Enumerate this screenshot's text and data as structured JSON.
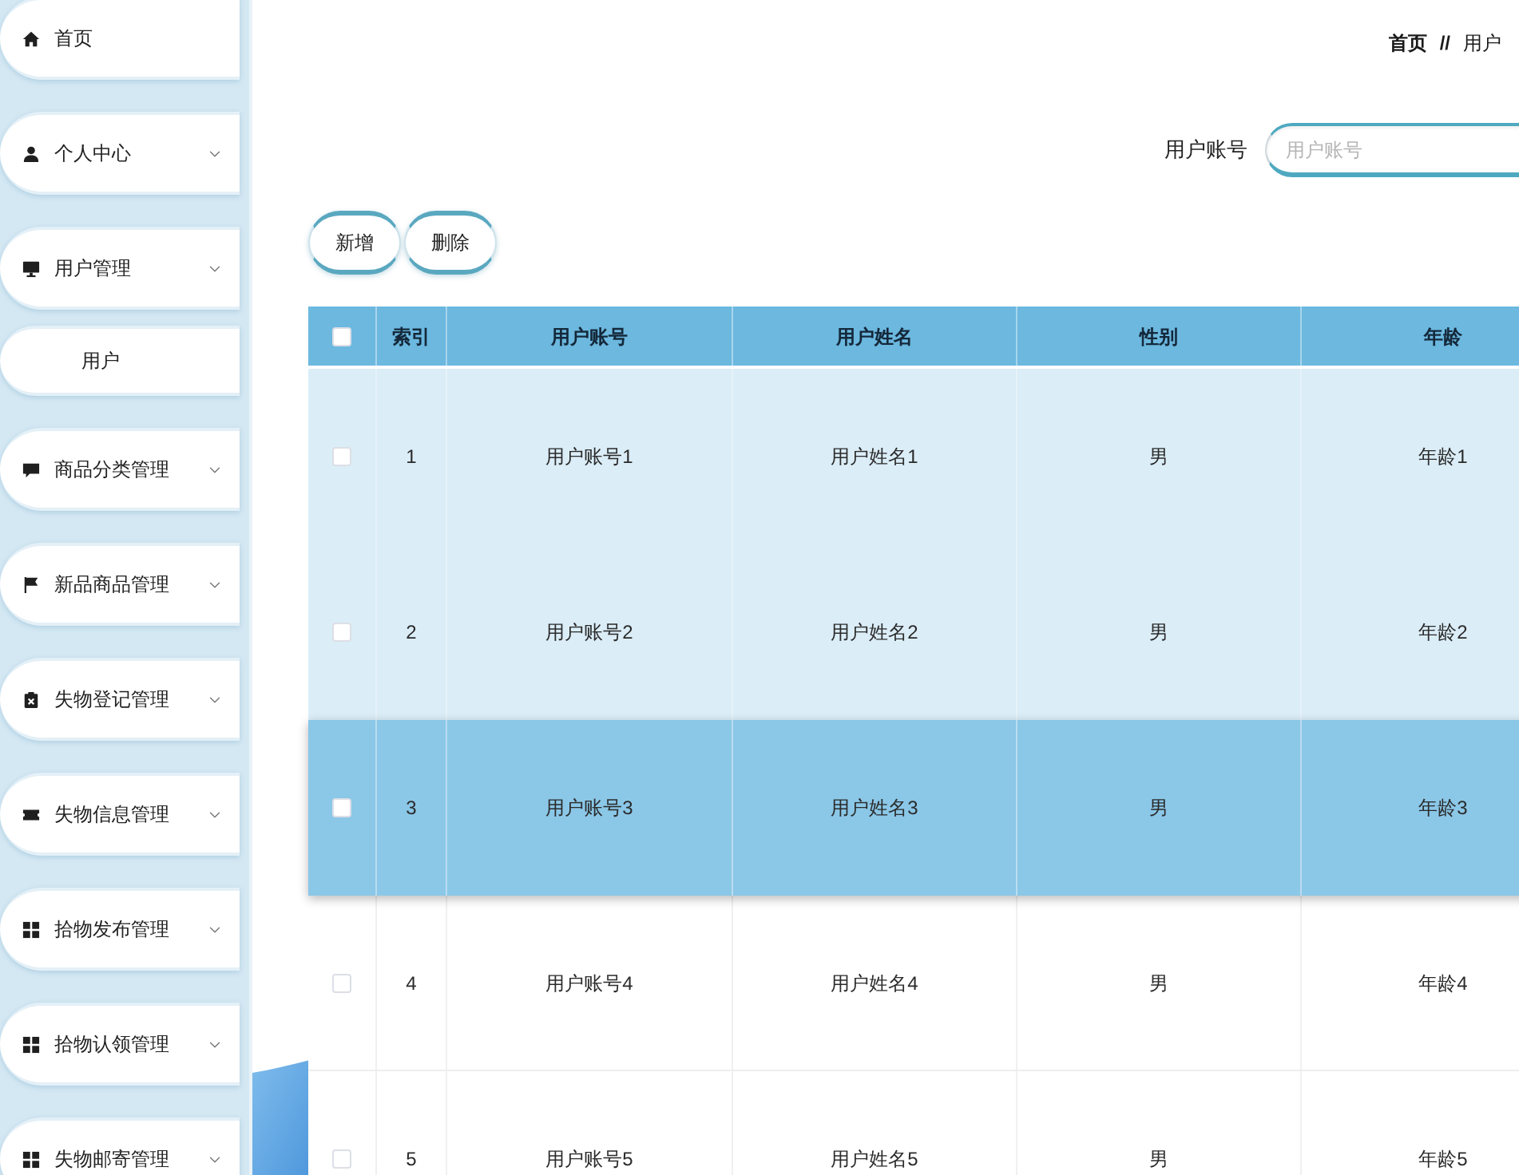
{
  "sidebar": {
    "items": [
      {
        "label": "首页",
        "kind": "link"
      },
      {
        "label": "个人中心",
        "kind": "submenu"
      },
      {
        "label": "用户管理",
        "kind": "submenu",
        "children": [
          {
            "label": "用户"
          }
        ]
      },
      {
        "label": "商品分类管理",
        "kind": "submenu"
      },
      {
        "label": "新品商品管理",
        "kind": "submenu"
      },
      {
        "label": "失物登记管理",
        "kind": "submenu"
      },
      {
        "label": "失物信息管理",
        "kind": "submenu"
      },
      {
        "label": "拾物发布管理",
        "kind": "submenu"
      },
      {
        "label": "拾物认领管理",
        "kind": "submenu"
      },
      {
        "label": "失物邮寄管理",
        "kind": "submenu"
      }
    ]
  },
  "breadcrumb": {
    "items": [
      "首页",
      "用户"
    ],
    "separator": "//"
  },
  "search": {
    "label": "用户账号",
    "placeholder": "用户账号"
  },
  "buttons": [
    "新增",
    "删除"
  ],
  "table": {
    "header_checked": false,
    "columns": [
      "索引",
      "用户账号",
      "用户姓名",
      "性别",
      "年龄"
    ],
    "rows": [
      {
        "cells": [
          "1",
          "用户账号1",
          "用户姓名1",
          "男",
          "年龄1"
        ],
        "checked": false,
        "selected": false,
        "highlighted": true
      },
      {
        "cells": [
          "2",
          "用户账号2",
          "用户姓名2",
          "男",
          "年龄2"
        ],
        "checked": false,
        "selected": false,
        "highlighted": true
      },
      {
        "cells": [
          "3",
          "用户账号3",
          "用户姓名3",
          "男",
          "年龄3"
        ],
        "checked": false,
        "selected": true,
        "highlighted": false
      },
      {
        "cells": [
          "4",
          "用户账号4",
          "用户姓名4",
          "男",
          "年龄4"
        ],
        "checked": false,
        "selected": false,
        "highlighted": false
      },
      {
        "cells": [
          "5",
          "用户账号5",
          "用户姓名5",
          "男",
          "年龄5"
        ],
        "checked": false,
        "selected": false,
        "highlighted": false
      }
    ]
  }
}
